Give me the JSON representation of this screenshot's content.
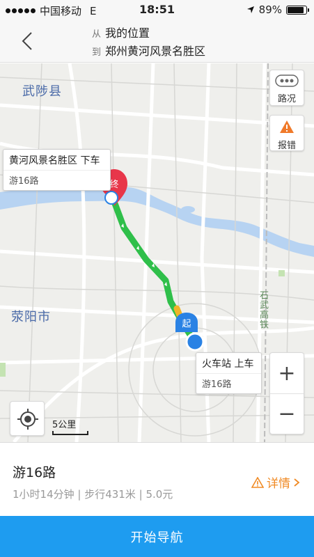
{
  "status_bar": {
    "carrier": "中国移动",
    "network": "E",
    "time": "18:51",
    "battery": "89%",
    "battery_level": 0.89
  },
  "header": {
    "from_key": "从",
    "from_value": "我的位置",
    "to_key": "到",
    "to_value": "郑州黄河风景名胜区"
  },
  "map": {
    "cities": [
      "武陟县",
      "荥阳市"
    ],
    "railway_label": "石武高铁",
    "controls": {
      "traffic_label": "路况",
      "report_label": "报错",
      "zoom_in": "+",
      "zoom_out": "−"
    },
    "scale_label": "5公里",
    "end_callout": {
      "title": "黄河风景名胜区 下车",
      "subtitle": "游16路"
    },
    "start_callout": {
      "title": "火车站 上车",
      "subtitle": "游16路"
    },
    "start_marker_text": "起",
    "end_marker_text": "终",
    "route_color": "#2fbf4a",
    "river_color": "#b7d3f2"
  },
  "info": {
    "line": "游16路",
    "meta": "1小时14分钟 | 步行431米 | 5.0元",
    "detail_label": "详情",
    "accent_color": "#f08a24"
  },
  "nav_button": {
    "label": "开始导航",
    "color": "#1e9cf0"
  }
}
